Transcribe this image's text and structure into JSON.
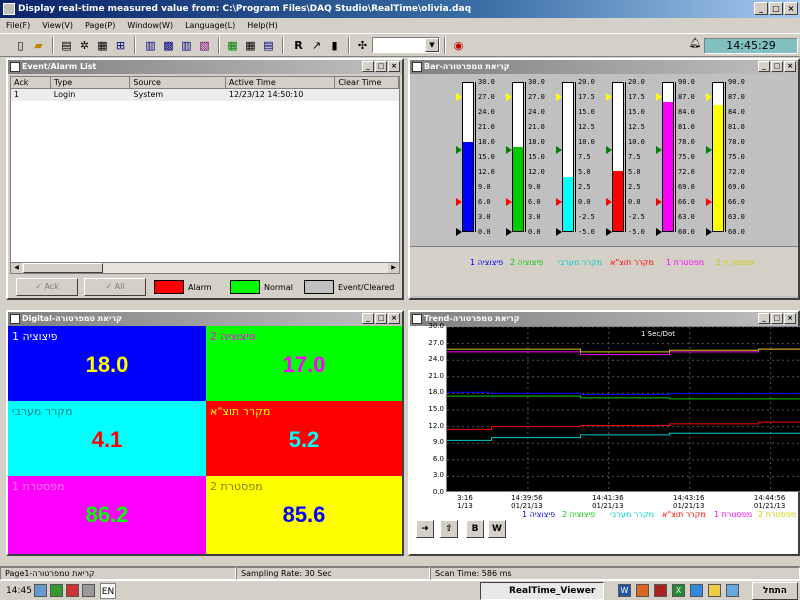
{
  "window": {
    "title": "Display real-time measured value from: C:\\Program Files\\DAQ Studio\\RealTime\\olivia.daq",
    "min": "_",
    "max": "□",
    "close": "×"
  },
  "menu": [
    "File(F)",
    "View(V)",
    "Page(P)",
    "Window(W)",
    "Language(L)",
    "Help(H)"
  ],
  "toolbar": {
    "clock": "14:45:29",
    "bell_icon": "bell-icon"
  },
  "event_panel": {
    "title": "Event/Alarm List",
    "columns": [
      "Ack",
      "Type",
      "Source",
      "Active Time",
      "Clear Time"
    ],
    "rows": [
      [
        "1",
        "Login",
        "System",
        "12/23/12 14:50:10",
        ""
      ]
    ],
    "ack_label": "Ack",
    "ack_all_label": "All",
    "legend": [
      {
        "label": "Alarm",
        "color": "#ff0000"
      },
      {
        "label": "Normal",
        "color": "#00ff00"
      },
      {
        "label": "Event/Cleared",
        "color": "#c0c0c0"
      }
    ]
  },
  "bar_panel": {
    "title": "Bar-קריאת טמפרטורה",
    "tanks": [
      {
        "scale": [
          "30.0",
          "27.0",
          "24.0",
          "21.0",
          "18.0",
          "15.0",
          "12.0",
          "9.0",
          "6.0",
          "3.0",
          "0.0"
        ],
        "min": 0,
        "max": 30,
        "value": 18.0,
        "color": "#0000ff"
      },
      {
        "scale": [
          "30.0",
          "27.0",
          "24.0",
          "21.0",
          "18.0",
          "15.0",
          "12.0",
          "9.0",
          "6.0",
          "3.0",
          "0.0"
        ],
        "min": 0,
        "max": 30,
        "value": 17.0,
        "color": "#00cc00"
      },
      {
        "scale": [
          "20.0",
          "17.5",
          "15.0",
          "12.5",
          "10.0",
          "7.5",
          "5.0",
          "2.5",
          "0.0",
          "-2.5",
          "-5.0"
        ],
        "min": -5,
        "max": 20,
        "value": 4.1,
        "color": "#00ffff"
      },
      {
        "scale": [
          "20.0",
          "17.5",
          "15.0",
          "12.5",
          "10.0",
          "7.5",
          "5.0",
          "2.5",
          "0.0",
          "-2.5",
          "-5.0"
        ],
        "min": -5,
        "max": 20,
        "value": 5.2,
        "color": "#ff0000"
      },
      {
        "scale": [
          "90.0",
          "87.0",
          "84.0",
          "81.0",
          "78.0",
          "75.0",
          "72.0",
          "69.0",
          "66.0",
          "63.0",
          "60.0"
        ],
        "min": 60,
        "max": 90,
        "value": 86.2,
        "color": "#ff00ff"
      },
      {
        "scale": [
          "90.0",
          "87.0",
          "84.0",
          "81.0",
          "78.0",
          "75.0",
          "72.0",
          "69.0",
          "66.0",
          "63.0",
          "60.0"
        ],
        "min": 60,
        "max": 90,
        "value": 85.6,
        "color": "#ffff00"
      }
    ],
    "legend": [
      {
        "label": "1 פיצוציה",
        "color": "#0000ff"
      },
      {
        "label": "2 פיצוציה",
        "color": "#00cc00"
      },
      {
        "label": "מקרר מערבי",
        "color": "#00cccc"
      },
      {
        "label": "מקרר תוצ\"א",
        "color": "#ff0000"
      },
      {
        "label": "מפסטרת 1",
        "color": "#ff00ff"
      },
      {
        "label": "מפסטרת 2",
        "color": "#cccc00"
      }
    ]
  },
  "digital_panel": {
    "title": "Digital-קריאת טמפרטורה",
    "cells": [
      {
        "label": "1 פיצוציה",
        "value": "18.0",
        "bg": "#0000ff",
        "fg": "#ffff00",
        "lab": "#ffffff"
      },
      {
        "label": "2 פיצוציה",
        "value": "17.0",
        "bg": "#00ff00",
        "fg": "#ff00ff",
        "lab": "#ff00ff"
      },
      {
        "label": "מקרר מערבי",
        "value": "4.1",
        "bg": "#00ffff",
        "fg": "#ff0000",
        "lab": "#008080"
      },
      {
        "label": "מקרר תוצ\"א",
        "value": "5.2",
        "bg": "#ff0000",
        "fg": "#00ffff",
        "lab": "#ffff00"
      },
      {
        "label": "מפסטרת 1",
        "value": "86.2",
        "bg": "#ff00ff",
        "fg": "#00ff00",
        "lab": "#ff80ff"
      },
      {
        "label": "מפסטרת 2",
        "value": "85.6",
        "bg": "#ffff00",
        "fg": "#0000ff",
        "lab": "#808000"
      }
    ]
  },
  "trend_panel": {
    "title": "Trend-קריאת טמפרטורה",
    "rate": "1 Sec/Dot",
    "yticks": [
      "30.0",
      "27.0",
      "24.0",
      "21.0",
      "18.0",
      "15.0",
      "12.0",
      "9.0",
      "6.0",
      "3.0",
      "0.0"
    ],
    "xticks": [
      {
        "time": "3:16",
        "date": "1/13"
      },
      {
        "time": "14:39:56",
        "date": "01/21/13"
      },
      {
        "time": "14:41:36",
        "date": "01/21/13"
      },
      {
        "time": "14:43:16",
        "date": "01/21/13"
      },
      {
        "time": "14:44:56",
        "date": "01/21/13"
      }
    ],
    "legend": [
      {
        "label": "1 פיצוציה",
        "color": "#0000ff"
      },
      {
        "label": "2 פיצוציה",
        "color": "#00cc00"
      },
      {
        "label": "מקרר מערבי",
        "color": "#00cccc"
      },
      {
        "label": "מקרר תוצ\"א",
        "color": "#ff0000"
      },
      {
        "label": "מפסטרת 1",
        "color": "#ff00ff"
      },
      {
        "label": "מפסטרת 2",
        "color": "#cccc00"
      }
    ],
    "btn_b": "B",
    "btn_w": "W"
  },
  "chart_data": {
    "type": "line",
    "ylim": [
      0,
      30
    ],
    "x": [
      "3:16",
      "14:39:56",
      "14:41:36",
      "14:43:16",
      "14:44:56"
    ],
    "series": [
      {
        "name": "1 פיצוציה",
        "color": "#0000ff",
        "values": [
          18.2,
          18.0,
          17.8,
          18.0,
          18.0
        ]
      },
      {
        "name": "2 פיצוציה",
        "color": "#00cc00",
        "values": [
          17.5,
          17.5,
          17.2,
          17.0,
          17.0
        ]
      },
      {
        "name": "מקרר מערבי",
        "color": "#00cccc",
        "values": [
          9.5,
          10.0,
          10.5,
          10.8,
          10.8
        ]
      },
      {
        "name": "מקרר תוצ\"א",
        "color": "#ff0000",
        "values": [
          11.5,
          12.0,
          12.2,
          12.5,
          12.8
        ]
      },
      {
        "name": "מפסטרת 1",
        "color": "#ff00ff",
        "values": [
          25.5,
          25.5,
          25.0,
          25.5,
          26.0
        ]
      },
      {
        "name": "מפסטרת 2",
        "color": "#cccc00",
        "values": [
          26.0,
          26.0,
          25.5,
          25.8,
          26.0
        ]
      }
    ]
  },
  "status": {
    "page": "Page1-קריאת טמפרטורה",
    "sampling": "Sampling Rate: 30 Sec",
    "scan": "Scan Time: 586 ms"
  },
  "taskbar": {
    "time": "14:45",
    "lang": "EN",
    "app": "RealTime_Viewer",
    "start": "התחל"
  }
}
